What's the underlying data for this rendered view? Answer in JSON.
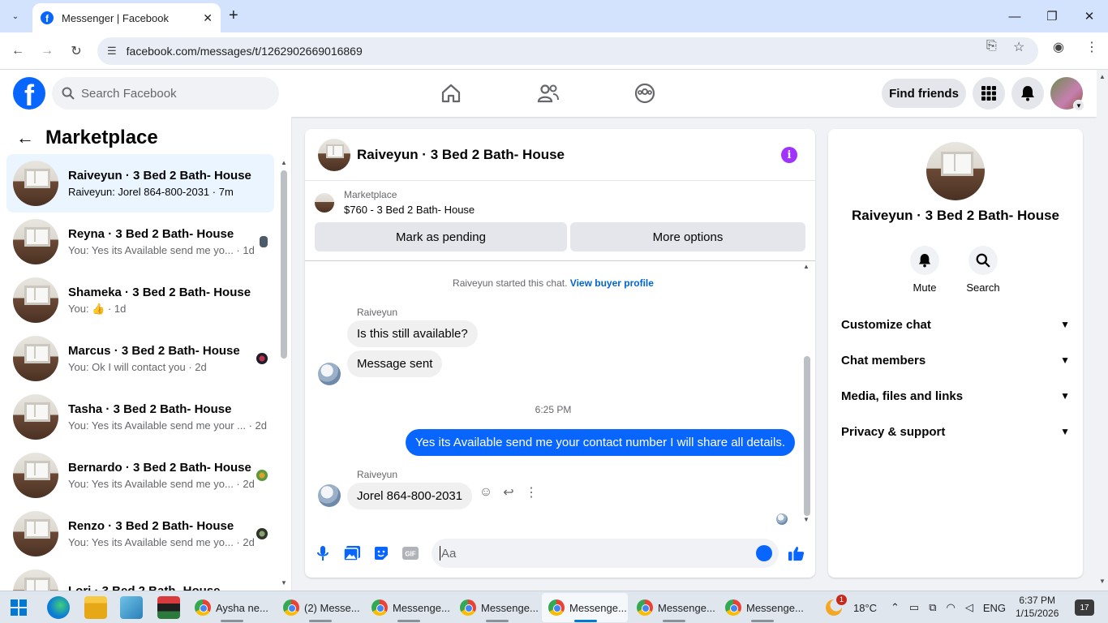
{
  "browser": {
    "tab_title": "Messenger | Facebook",
    "url": "facebook.com/messages/t/1262902669016869"
  },
  "fb": {
    "search_placeholder": "Search Facebook",
    "find_friends": "Find friends",
    "logo": "f"
  },
  "left": {
    "title": "Marketplace",
    "chats": [
      {
        "name": "Raiveyun · 3 Bed 2 Bath- House",
        "preview": "Raiveyun: Jorel 864-800-2031 · 7m",
        "active": true,
        "unread": true
      },
      {
        "name": "Reyna · 3 Bed 2 Bath- House",
        "preview": "You: Yes its Available send me yo... · 1d"
      },
      {
        "name": "Shameka · 3 Bed 2 Bath- House",
        "preview": "You: 👍 · 1d"
      },
      {
        "name": "Marcus · 3 Bed 2 Bath- House",
        "preview": "You: Ok I will contact you · 2d"
      },
      {
        "name": "Tasha · 3 Bed 2 Bath- House",
        "preview": "You: Yes its Available send me your ... · 2d"
      },
      {
        "name": "Bernardo · 3 Bed 2 Bath- House",
        "preview": "You: Yes its Available send me yo... · 2d"
      },
      {
        "name": "Renzo · 3 Bed 2 Bath- House",
        "preview": "You: Yes its Available send me yo... · 2d"
      },
      {
        "name": "Lori · 3 Bed 2 Bath- House",
        "preview": ""
      }
    ]
  },
  "conversation": {
    "title": "Raiveyun · 3 Bed 2 Bath- House",
    "marketplace_label": "Marketplace",
    "listing": "$760 - 3 Bed 2 Bath- House",
    "mark_pending": "Mark as pending",
    "more_options": "More options",
    "started_text": "Raiveyun started this chat.",
    "view_buyer_profile": "View buyer profile",
    "sender_name": "Raiveyun",
    "msg1": "Is this still available?",
    "msg2": "Message sent",
    "timestamp": "6:25 PM",
    "msg_out": "Yes its Available send me your contact number I will share all details.",
    "msg3": "Jorel 864-800-2031",
    "composer_placeholder": "Aa"
  },
  "info": {
    "name": "Raiveyun · 3 Bed 2 Bath- House",
    "mute": "Mute",
    "search": "Search",
    "sections": [
      "Customize chat",
      "Chat members",
      "Media, files and links",
      "Privacy & support"
    ]
  },
  "taskbar": {
    "windows": [
      "Aysha ne...",
      "(2) Messe...",
      "Messenge...",
      "Messenge...",
      "Messenge...",
      "Messenge...",
      "Messenge..."
    ],
    "weather": "18°C",
    "weather_badge": "1",
    "lang": "ENG",
    "time": "6:37 PM",
    "date": "1/15/2026",
    "notifications": "17"
  },
  "colors": {
    "fb_blue": "#0866ff",
    "active_chat": "#ebf5ff",
    "info_purple": "#a033ff"
  }
}
